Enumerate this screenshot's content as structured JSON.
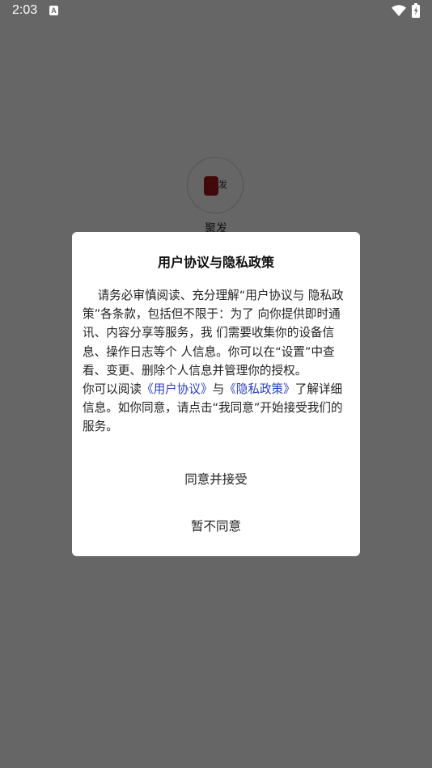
{
  "status_bar": {
    "time": "2:03",
    "notification_icon": "a-icon",
    "notification_glyph": "A",
    "icons": [
      "wifi-icon",
      "battery-icon"
    ]
  },
  "app": {
    "name": "聚发",
    "logo_text": "发"
  },
  "dialog": {
    "title": "用户协议与隐私政策",
    "paragraph1": "请务必审慎阅读、充分理解“用户协议与 隐私政策”各条款，包括但不限于：为了 向你提供即时通讯、内容分享等服务，我 们需要收集你的设备信息、操作日志等个 人信息。你可以在“设置”中查看、变更、删除个人信息并管理你的授权。",
    "p2_prefix": "你可以阅读",
    "user_agreement_link": "《用户协议》",
    "p2_and": "与",
    "privacy_policy_link": "《隐私政策》",
    "p2_suffix": "了解详细信息。如你同意，请点击“我同意”开始接受我们的服务。",
    "agree_button": "同意并接受",
    "disagree_button": "暂不同意"
  },
  "colors": {
    "overlay": "rgba(0,0,0,0.6)",
    "link": "#2c3fb5",
    "logo_red": "#a3181b"
  }
}
